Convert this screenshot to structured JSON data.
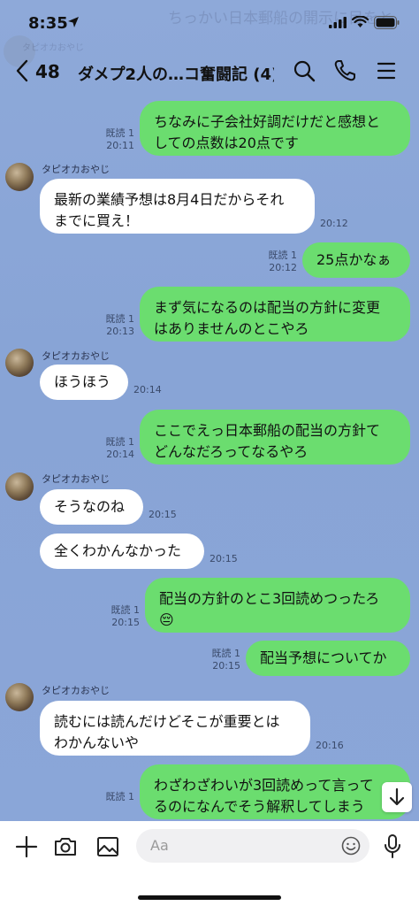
{
  "status_bar": {
    "time": "8:35"
  },
  "background_ghost": {
    "banner_text": "ちっかい日本郵船の開示に目をと",
    "name_text": "タピオカおやじ"
  },
  "header": {
    "back_count": "48",
    "title": "ダメプ2人の…コ奮闘記 (4)"
  },
  "messages": [
    {
      "side": "mine",
      "lines": [
        "ちなみに子会社好調だけだと感想と",
        "しての点数は20点です"
      ],
      "read": "既読 1",
      "time": "20:11"
    },
    {
      "side": "theirs",
      "sender": "タピオカおやじ",
      "lines": [
        "最新の業績予想は8月4日だからそれ",
        "までに買え！"
      ],
      "time": "20:12"
    },
    {
      "side": "mine",
      "lines": [
        "25点かなぁ"
      ],
      "read": "既読 1",
      "time": "20:12"
    },
    {
      "side": "mine",
      "lines": [
        "まず気になるのは配当の方針に変更",
        "はありませんのとこやろ"
      ],
      "read": "既読 1",
      "time": "20:13"
    },
    {
      "side": "theirs",
      "sender": "タピオカおやじ",
      "lines": [
        "ほうほう"
      ],
      "time": "20:14"
    },
    {
      "side": "mine",
      "lines": [
        "ここでえっ日本郵船の配当の方針て",
        "どんなだろってなるやろ"
      ],
      "read": "既読 1",
      "time": "20:14"
    },
    {
      "side": "theirs",
      "sender": "タピオカおやじ",
      "lines": [
        "そうなのね"
      ],
      "time": "20:15"
    },
    {
      "side": "theirs",
      "lines": [
        "全くわかんなかった"
      ],
      "time": "20:15"
    },
    {
      "side": "mine",
      "lines": [
        "配当の方針のとこ3回読めつったろ",
        "😔"
      ],
      "read": "既読 1",
      "time": "20:15"
    },
    {
      "side": "mine",
      "lines": [
        "配当予想についてか"
      ],
      "read": "既読 1",
      "time": "20:15"
    },
    {
      "side": "theirs",
      "sender": "タピオカおやじ",
      "lines": [
        "読むには読んだけどそこが重要とは",
        "わかんないや"
      ],
      "time": "20:16"
    },
    {
      "side": "mine",
      "lines": [
        "わざわざわいが3回読めって言って",
        "るのになんでそう解釈してしまう"
      ],
      "read": "既読 1",
      "time": ""
    }
  ],
  "composer": {
    "placeholder": "Aa"
  },
  "icons": {
    "location": "location-arrow-icon",
    "signal": "signal-icon",
    "wifi": "wifi-icon",
    "battery": "battery-icon",
    "back": "chevron-left-icon",
    "search": "search-icon",
    "call": "phone-icon",
    "menu": "menu-icon",
    "plus": "plus-icon",
    "camera": "camera-icon",
    "image": "image-icon",
    "emoji": "emoji-icon",
    "mic": "microphone-icon",
    "scroll": "arrow-down-icon"
  },
  "colors": {
    "my_bubble": "#6bdd6f",
    "their_bubble": "#ffffff",
    "background": "#8aa7d8"
  }
}
